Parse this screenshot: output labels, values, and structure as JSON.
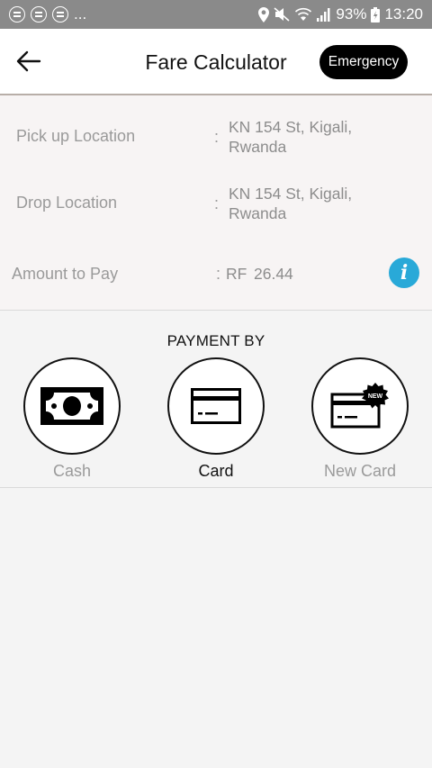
{
  "status_bar": {
    "battery": "93%",
    "time": "13:20",
    "overflow": "..."
  },
  "header": {
    "title": "Fare Calculator",
    "emergency_label": "Emergency"
  },
  "details": {
    "pickup": {
      "label": "Pick up Location",
      "colon": ":",
      "value_line1": "KN 154 St, Kigali,",
      "value_line2": "Rwanda"
    },
    "drop": {
      "label": "Drop Location",
      "colon": ":",
      "value_line1": "KN 154 St, Kigali,",
      "value_line2": "Rwanda"
    },
    "amount": {
      "label": "Amount to Pay",
      "colon": ":",
      "currency": "RF",
      "value": "26.44",
      "info_glyph": "i"
    }
  },
  "payment": {
    "title": "PAYMENT BY",
    "options": [
      {
        "label": "Cash",
        "icon": "cash-icon",
        "selected": false
      },
      {
        "label": "Card",
        "icon": "card-icon",
        "selected": true
      },
      {
        "label": "New Card",
        "icon": "new-card-icon",
        "selected": false,
        "badge": "NEW"
      }
    ]
  },
  "colors": {
    "status_bar": "#8a8a8a",
    "info_accent": "#29a9d8",
    "emergency_bg": "#000000"
  }
}
